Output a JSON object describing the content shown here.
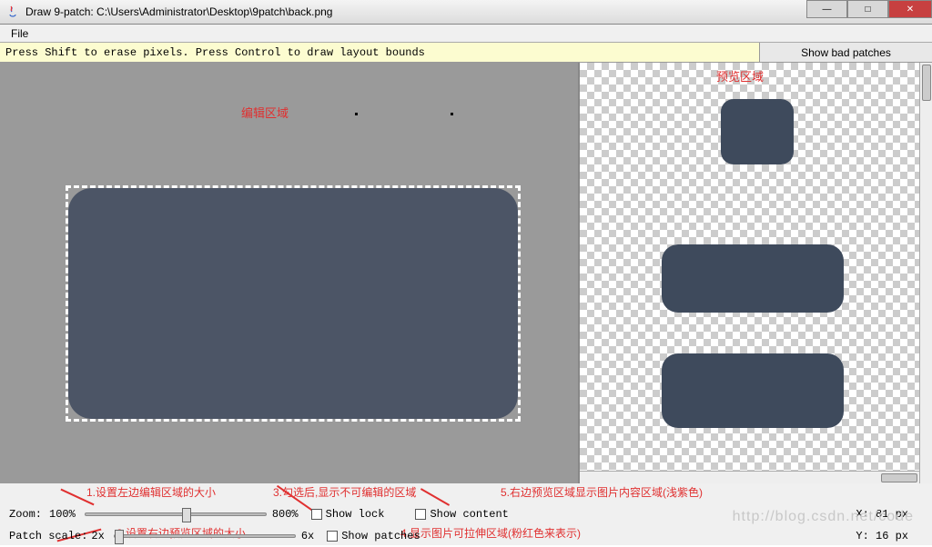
{
  "window": {
    "title": "Draw 9-patch: C:\\Users\\Administrator\\Desktop\\9patch\\back.png"
  },
  "menu": {
    "file": "File"
  },
  "hint": {
    "text": "Press Shift to erase pixels. Press Control to draw layout bounds",
    "button": "Show bad patches"
  },
  "labels": {
    "edit_area": "编辑区域",
    "preview_area": "预览区域"
  },
  "controls": {
    "zoom_label": "Zoom:",
    "zoom_min": "100%",
    "zoom_max": "800%",
    "patch_scale_label": "Patch scale:",
    "patch_min": "2x",
    "patch_max": "6x",
    "show_lock": "Show lock",
    "show_patches": "Show patches",
    "show_content": "Show content"
  },
  "status": {
    "x": "X: 81 px",
    "y": "Y: 16 px"
  },
  "annotations": {
    "a1": "1.设置左边编辑区域的大小",
    "a2": "2.设置右边预览区域的大小",
    "a3": "3.勾选后,显示不可编辑的区域",
    "a4": "4.显示图片可拉伸区域(粉红色来表示)",
    "a5": "5.右边预览区域显示图片内容区域(浅紫色)"
  },
  "watermark": "http://blog.csdn.net/code"
}
